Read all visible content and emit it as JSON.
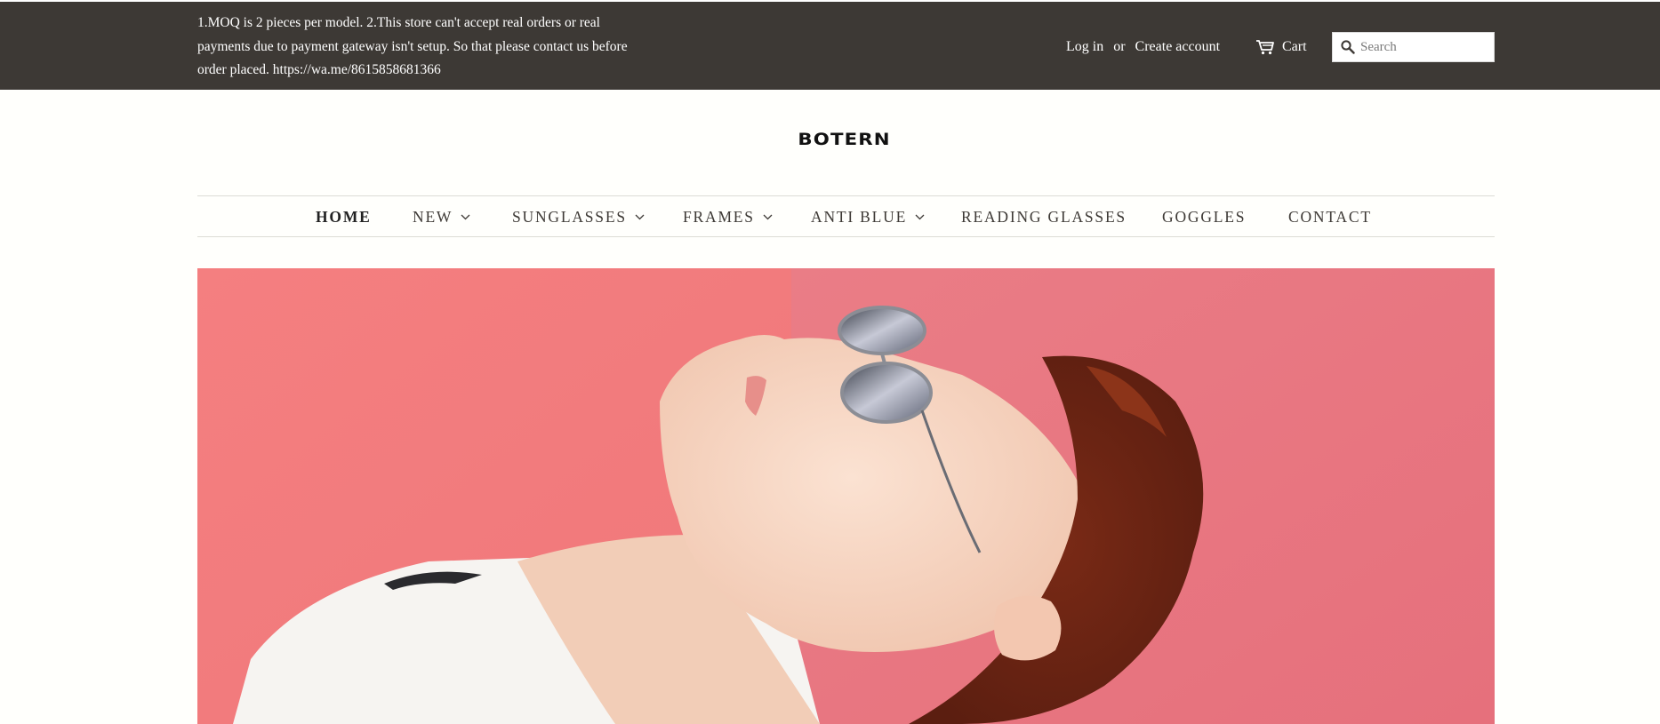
{
  "announcement": {
    "text": "1.MOQ is 2 pieces per model. 2.This store can't accept real orders or real payments due to payment gateway isn't setup. So that please contact us before order placed. https://wa.me/8615858681366"
  },
  "header": {
    "login_label": "Log in",
    "or_label": "or",
    "create_account_label": "Create account",
    "cart_label": "Cart",
    "search_placeholder": "Search",
    "cart_icon": "cart-icon",
    "search_icon": "search-icon"
  },
  "logo": {
    "text": "BOTERN"
  },
  "nav": {
    "items": [
      {
        "label": "HOME",
        "dropdown": false
      },
      {
        "label": "NEW",
        "dropdown": true
      },
      {
        "label": "SUNGLASSES",
        "dropdown": true
      },
      {
        "label": "FRAMES",
        "dropdown": true
      },
      {
        "label": "ANTI BLUE",
        "dropdown": true
      },
      {
        "label": "READING GLASSES",
        "dropdown": false
      },
      {
        "label": "GOGGLES",
        "dropdown": false
      },
      {
        "label": "CONTACT",
        "dropdown": false
      }
    ]
  },
  "hero": {
    "image": "woman-sunglasses-photo"
  },
  "colors": {
    "top_bar": "#3d3935",
    "background": "#fffffc",
    "hero_pink": "#f07c7d",
    "text": "#3d3935"
  }
}
